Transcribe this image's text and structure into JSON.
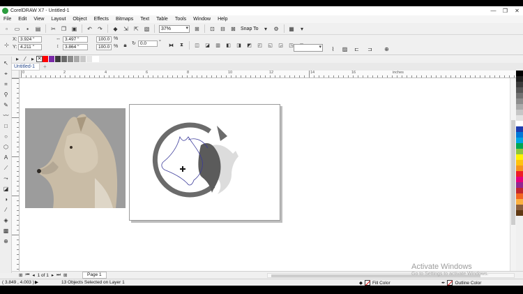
{
  "window": {
    "title": "CorelDRAW X7 - Untitled-1",
    "controls": [
      "—",
      "❐",
      "✕"
    ]
  },
  "menu": [
    "File",
    "Edit",
    "View",
    "Layout",
    "Object",
    "Effects",
    "Bitmaps",
    "Text",
    "Table",
    "Tools",
    "Window",
    "Help"
  ],
  "toolbar": {
    "zoom_value": "37%",
    "snap_label": "Snap To"
  },
  "properties": {
    "x_label": "X:",
    "x_value": "3.924 \"",
    "y_label": "Y:",
    "y_value": "4.211 \"",
    "w_value": "3.497 \"",
    "h_value": "3.864 \"",
    "scale_x": "100.0",
    "scale_y": "100.0",
    "pct": "%",
    "angle_value": "0.0",
    "deg": "°"
  },
  "document_tab": "Untitled-1",
  "ruler": {
    "labels": [
      "0",
      "2",
      "4",
      "6",
      "8",
      "10",
      "12",
      "14",
      "16",
      "inches"
    ]
  },
  "page_nav": {
    "page_of": "1 of 1",
    "page_tab": "Page 1"
  },
  "status": {
    "coords": "( 3.849 , 4.003 )",
    "selection": "13 Objects Selected on Layer 1",
    "fill": "Fill Color",
    "outline": "Outline Color"
  },
  "watermark": {
    "line1": "Activate Windows",
    "line2": "Go to Settings to activate Windows."
  },
  "palette_colors": [
    "#ff0000",
    "#7a2aa8",
    "#3b3b3b",
    "#6a6a6a",
    "#8c8c8c",
    "#a9a9a9",
    "#c8c8c8",
    "#e6e6e6",
    "#ffffff"
  ],
  "right_palette_colors": [
    "#000000",
    "#1e1e1e",
    "#3a3a3a",
    "#555555",
    "#717171",
    "#8d8d8d",
    "#aaaaaa",
    "#c6c6c6",
    "#e2e2e2",
    "#ffffff",
    "#1e3cae",
    "#0078d7",
    "#00a4e4",
    "#00a651",
    "#8dc63f",
    "#fff200",
    "#ffc20e",
    "#f7941d",
    "#ed1c24",
    "#e4007c",
    "#92278f",
    "#c1272d",
    "#f26522",
    "#fbb040",
    "#8b5e3c",
    "#603913"
  ]
}
